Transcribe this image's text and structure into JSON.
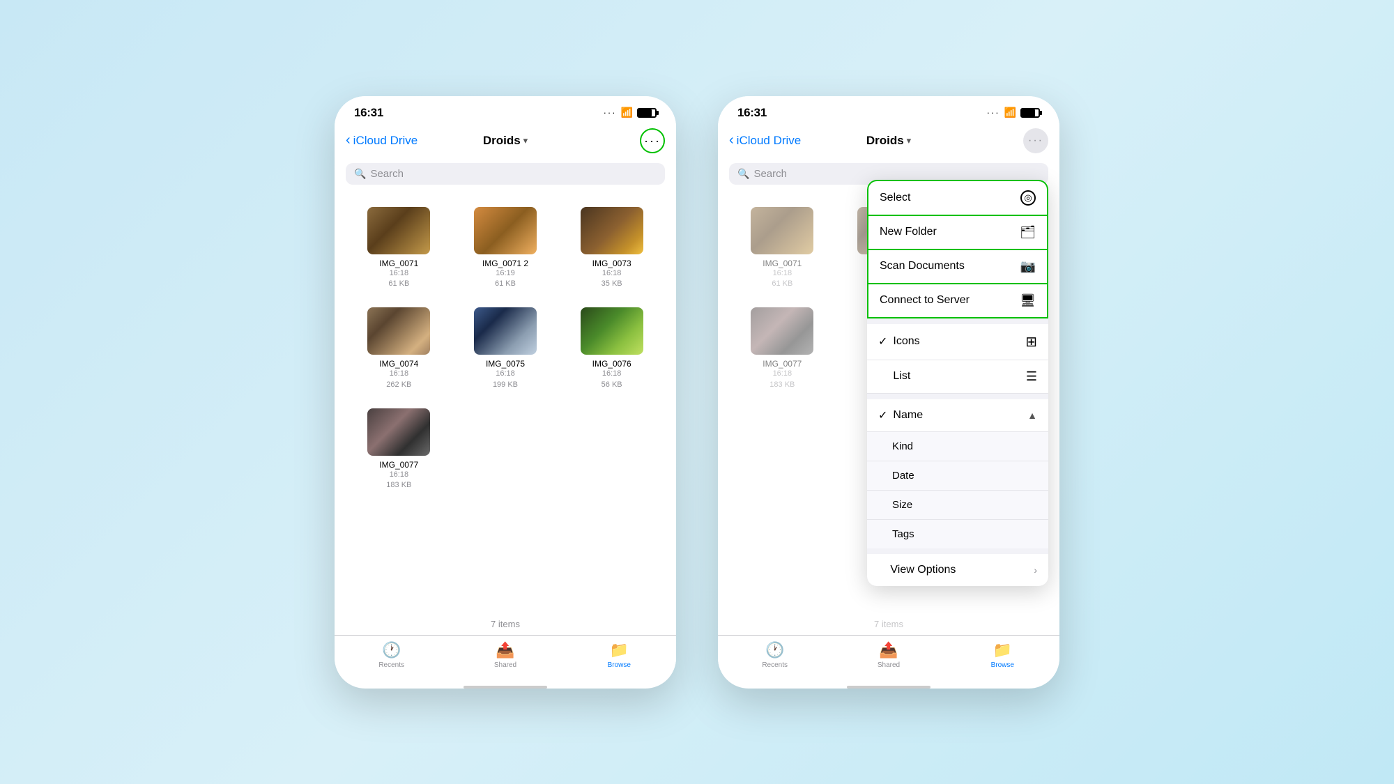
{
  "left_phone": {
    "status": {
      "time": "16:31",
      "dots": "···",
      "wifi": "📶",
      "battery_level": 80
    },
    "nav": {
      "back_label": "iCloud Drive",
      "title": "Droids",
      "title_chevron": "▾",
      "ellipsis_label": "···"
    },
    "search": {
      "placeholder": "Search"
    },
    "files": [
      {
        "name": "IMG_0071",
        "time": "16:18",
        "size": "61 KB",
        "thumb_class": "thumb-0071"
      },
      {
        "name": "IMG_0071 2",
        "time": "16:19",
        "size": "61 KB",
        "thumb_class": "thumb-0071-2"
      },
      {
        "name": "IMG_0073",
        "time": "16:18",
        "size": "35 KB",
        "thumb_class": "thumb-0073"
      },
      {
        "name": "IMG_0074",
        "time": "16:18",
        "size": "262 KB",
        "thumb_class": "thumb-0074"
      },
      {
        "name": "IMG_0075",
        "time": "16:18",
        "size": "199 KB",
        "thumb_class": "thumb-0075"
      },
      {
        "name": "IMG_0076",
        "time": "16:18",
        "size": "56 KB",
        "thumb_class": "thumb-0076"
      },
      {
        "name": "IMG_0077",
        "time": "16:18",
        "size": "183 KB",
        "thumb_class": "thumb-0077"
      }
    ],
    "item_count": "7 items",
    "tabs": [
      {
        "icon": "🕐",
        "label": "Recents",
        "active": false
      },
      {
        "icon": "📤",
        "label": "Shared",
        "active": false
      },
      {
        "icon": "📁",
        "label": "Browse",
        "active": true
      }
    ]
  },
  "right_phone": {
    "status": {
      "time": "16:31",
      "dots": "···",
      "wifi": "📶",
      "battery_level": 80
    },
    "nav": {
      "back_label": "iCloud Drive",
      "title": "Droids",
      "title_chevron": "▾",
      "ellipsis_label": "···"
    },
    "search": {
      "placeholder": "Search"
    },
    "dropdown": {
      "items": [
        {
          "id": "select",
          "label": "Select",
          "icon": "◎",
          "highlighted": true,
          "check": ""
        },
        {
          "id": "new-folder",
          "label": "New Folder",
          "icon": "🗂",
          "highlighted": false,
          "check": ""
        },
        {
          "id": "scan-documents",
          "label": "Scan Documents",
          "icon": "📷",
          "highlighted": false,
          "check": ""
        },
        {
          "id": "connect-server",
          "label": "Connect to Server",
          "icon": "🖥",
          "highlighted": false,
          "check": ""
        }
      ],
      "view_section": [
        {
          "id": "icons",
          "label": "Icons",
          "icon": "⊞",
          "check": "✓",
          "active": true
        },
        {
          "id": "list",
          "label": "List",
          "icon": "☰",
          "check": "",
          "active": false
        }
      ],
      "sort_section": {
        "label": "Name",
        "check": "✓",
        "chevron": "▲",
        "sub_items": [
          {
            "id": "kind",
            "label": "Kind"
          },
          {
            "id": "date",
            "label": "Date"
          },
          {
            "id": "size",
            "label": "Size"
          },
          {
            "id": "tags",
            "label": "Tags"
          }
        ]
      },
      "view_options": {
        "label": "View Options",
        "chevron": "›"
      }
    },
    "visible_files": [
      {
        "name": "IMG_0071",
        "time": "16:18",
        "size": "61 KB",
        "thumb_class": "thumb-0071"
      },
      {
        "name": "IMG_0074",
        "time": "16:18",
        "size": "262 KB",
        "thumb_class": "thumb-0074"
      },
      {
        "name": "IMG_0077",
        "time": "16:18",
        "size": "183 KB",
        "thumb_class": "thumb-0077"
      }
    ],
    "item_count": "7 items",
    "tabs": [
      {
        "icon": "🕐",
        "label": "Recents",
        "active": false
      },
      {
        "icon": "📤",
        "label": "Shared",
        "active": false
      },
      {
        "icon": "📁",
        "label": "Browse",
        "active": true
      }
    ]
  }
}
